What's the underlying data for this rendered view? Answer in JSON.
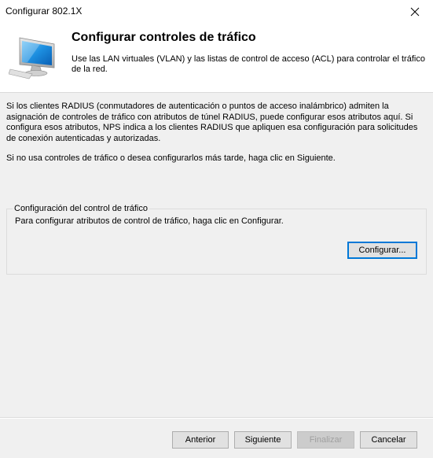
{
  "window": {
    "title": "Configurar 802.1X",
    "close_icon": "close-icon"
  },
  "header": {
    "icon": "monitor-icon",
    "heading": "Configurar controles de tráfico",
    "subtitle": "Use las LAN virtuales (VLAN) y las listas de control de acceso (ACL) para controlar el tráfico de la red."
  },
  "body": {
    "paragraph1": "Si los clientes RADIUS (conmutadores de autenticación o puntos de acceso inalámbrico) admiten la asignación de controles de tráfico con atributos de túnel RADIUS, puede configurar esos atributos aquí. Si configura esos atributos, NPS indica a los clientes RADIUS que apliquen esa configuración para solicitudes de conexión autenticadas y autorizadas.",
    "paragraph2": "Si no usa controles de tráfico o desea configurarlos más tarde, haga clic en Siguiente."
  },
  "traffic_group": {
    "legend": "Configuración del control de tráfico",
    "description": "Para configurar atributos de control de tráfico, haga clic en Configurar.",
    "configure_label": "Configurar..."
  },
  "footer": {
    "back_label": "Anterior",
    "next_label": "Siguiente",
    "finish_label": "Finalizar",
    "cancel_label": "Cancelar",
    "finish_enabled": false
  },
  "colors": {
    "dialog_bg": "#f0f0f0",
    "header_bg": "#ffffff",
    "button_bg": "#e1e1e1",
    "focus_border": "#0078d7",
    "disabled_text": "#a0a0a0"
  }
}
